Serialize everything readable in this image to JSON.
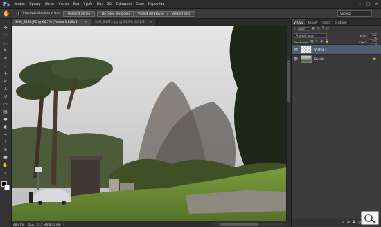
{
  "app": {
    "logo": "Ps"
  },
  "menu": [
    "Soubor",
    "Úpravy",
    "Obraz",
    "Vrstva",
    "Text",
    "Výběr",
    "Filtr",
    "3D",
    "Zobrazení",
    "Okno",
    "Nápověda"
  ],
  "window_controls": {
    "minimize": "–",
    "maximize": "□",
    "close": "✕"
  },
  "options": {
    "sample_all_layers": "Pracovat všechna vrstva",
    "button_1": "Upřesnit okraje",
    "button_2": "Na celou obrazovku",
    "button_3": "Vyplnit obrazovku",
    "button_4": "Velikost tisku",
    "workspace": "Výchozí"
  },
  "tabs": [
    {
      "label": "SAM_8556.JPG @ 66,7% (Vrstva 1,RGB/8) *",
      "close": "×"
    },
    {
      "label": "SAM_8467a.jpg @ 33,3% (RGB/8)",
      "close": "×"
    }
  ],
  "status": {
    "zoom": "66,67%",
    "doc": "Dok: 57,1 MB/80,1 MB",
    "arrow": "▸"
  },
  "panels": {
    "tabs": [
      "Vrstvy",
      "Kanály",
      "Cesty",
      "Historie"
    ],
    "kind": "Druh",
    "blend_mode": "Prolnutí barvy",
    "opacity_label": "Krytí:",
    "opacity_value": "100 %",
    "lock_label": "Zamknout:",
    "fill_label": "Výplň:",
    "fill_value": "100 %",
    "layers": [
      {
        "name": "Vrstva 1",
        "visible": true,
        "selected": true
      },
      {
        "name": "Pozadí",
        "visible": true,
        "selected": false,
        "locked": true
      }
    ],
    "footer_icons": [
      "link-icon",
      "fx-icon",
      "mask-icon",
      "adjustment-icon",
      "group-icon",
      "new-layer-icon",
      "trash-icon"
    ]
  },
  "tools": [
    "move",
    "marquee",
    "lasso",
    "quick-select",
    "crop",
    "eyedropper",
    "healing",
    "brush",
    "clone",
    "history-brush",
    "eraser",
    "gradient",
    "blur",
    "dodge",
    "pen",
    "type",
    "path-select",
    "shape",
    "hand",
    "zoom"
  ]
}
